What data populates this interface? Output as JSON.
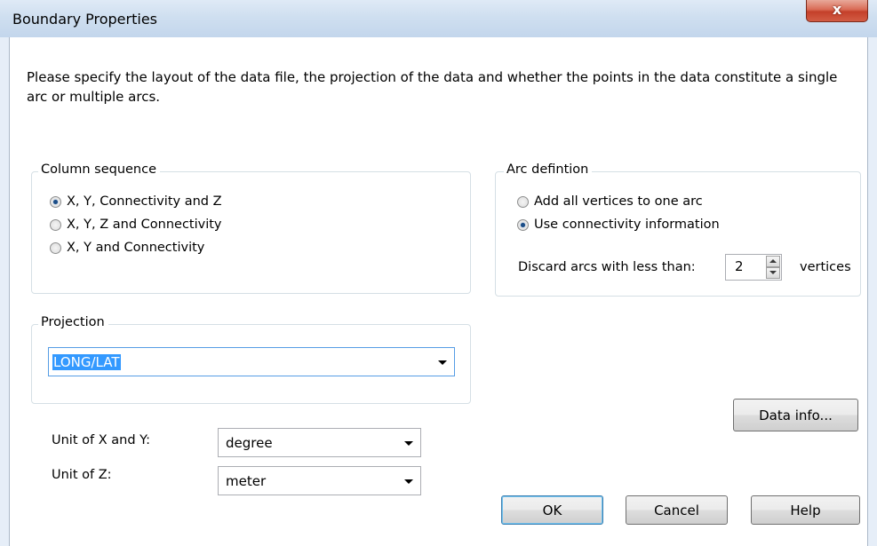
{
  "window": {
    "title": "Boundary Properties",
    "close_glyph": "x"
  },
  "intro_text": "Please specify the layout of the data file, the projection of the data and whether the points in the data constitute a single arc or multiple arcs.",
  "column_sequence": {
    "label": "Column sequence",
    "options": [
      {
        "label": "X, Y, Connectivity and Z",
        "checked": true
      },
      {
        "label": "X, Y, Z and Connectivity",
        "checked": false
      },
      {
        "label": "X, Y and Connectivity",
        "checked": false
      }
    ]
  },
  "arc_definition": {
    "label": "Arc defintion",
    "options": [
      {
        "label": "Add all vertices to one arc",
        "checked": false
      },
      {
        "label": "Use connectivity information",
        "checked": true
      }
    ],
    "discard_label": "Discard arcs with less than:",
    "discard_value": "2",
    "discard_unit": "vertices"
  },
  "projection": {
    "label": "Projection",
    "selected": "LONG/LAT"
  },
  "units": {
    "xy_label": "Unit of X and Y:",
    "xy_value": "degree",
    "z_label": "Unit of Z:",
    "z_value": "meter"
  },
  "buttons": {
    "data_info": "Data info...",
    "ok": "OK",
    "cancel": "Cancel",
    "help": "Help"
  },
  "colors": {
    "selection": "#3399ff",
    "close_button": "#c4402a",
    "radio_dot": "#1b4d87"
  }
}
